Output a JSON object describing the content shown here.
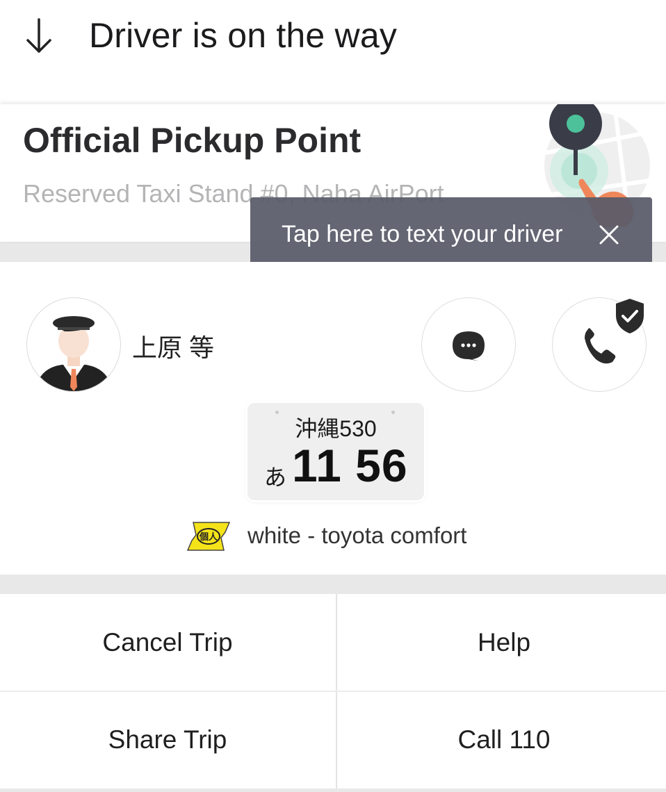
{
  "header": {
    "title": "Driver is on the way",
    "back_icon": "arrow-down-icon"
  },
  "pickup": {
    "title": "Official Pickup Point",
    "location": "Reserved Taxi Stand #0, Naha AirPort",
    "illustration_icon": "map-pin-tap-icon"
  },
  "tooltip": {
    "text": "Tap here to text your driver",
    "close_icon": "close-icon"
  },
  "driver": {
    "name": "上原 等",
    "message_icon": "chat-bubble-icon",
    "call_icon": "phone-icon",
    "verified_icon": "shield-check-icon"
  },
  "vehicle": {
    "plate_region": "沖縄530",
    "plate_kana": "あ",
    "plate_number": "11 56",
    "badge_text": "個人",
    "description": "white - toyota comfort"
  },
  "actions": {
    "cancel": "Cancel Trip",
    "help": "Help",
    "share": "Share Trip",
    "call_police": "Call 110"
  },
  "colors": {
    "tooltip_bg": "#585a68",
    "pin_dark": "#3a3c48",
    "pin_accent": "#4cc19a",
    "hand": "#f0875b",
    "badge_yellow": "#f5e31a"
  }
}
